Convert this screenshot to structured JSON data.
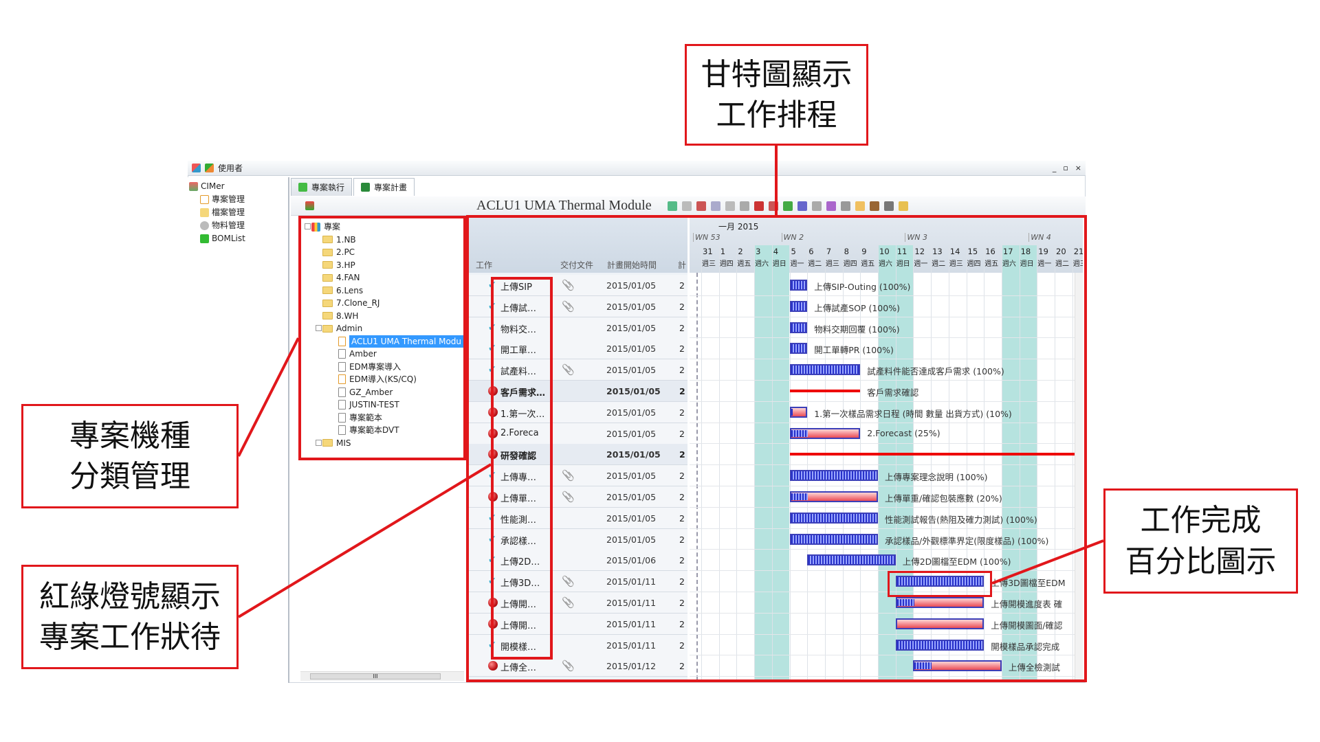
{
  "window": {
    "title": "使用者",
    "controls": [
      "_",
      "▫",
      "×"
    ]
  },
  "nav": {
    "root": "CIMer",
    "items": [
      {
        "label": "專案管理",
        "icon": "document-icon"
      },
      {
        "label": "檔案管理",
        "icon": "folder-icon"
      },
      {
        "label": "物料管理",
        "icon": "gear-icon"
      },
      {
        "label": "BOMList",
        "icon": "puzzle-icon"
      }
    ]
  },
  "tabs": [
    {
      "label": "專案執行"
    },
    {
      "label": "專案計畫",
      "active": true
    }
  ],
  "toolbar": {
    "project_title": "ACLU1 UMA Thermal Module"
  },
  "tree": {
    "root": "專案",
    "folders": [
      "1.NB",
      "2.PC",
      "3.HP",
      "4.FAN",
      "6.Lens",
      "7.Clone_RJ",
      "8.WH"
    ],
    "admin": {
      "label": "Admin",
      "children": [
        {
          "label": "ACLU1 UMA Thermal Modu",
          "selected": true,
          "orange": true
        },
        {
          "label": "Amber"
        },
        {
          "label": "EDM專案導入"
        },
        {
          "label": "EDM導入(KS/CQ)",
          "orange": true
        },
        {
          "label": "GZ_Amber"
        },
        {
          "label": "JUSTIN-TEST"
        },
        {
          "label": "專案範本"
        },
        {
          "label": "專案範本DVT"
        }
      ]
    },
    "collapsed": "MIS",
    "scroll_marker": "III"
  },
  "grid": {
    "columns": [
      "工作",
      "交付文件",
      "計畫開始時間",
      "計"
    ],
    "rows": [
      {
        "name": "上傳SIP",
        "status": "done",
        "attach": true,
        "start": "2015/01/05",
        "dur": "2",
        "gantt_label": "上傳SIP-Outing (100%)",
        "days": 1,
        "percent": 100
      },
      {
        "name": "上傳試…",
        "status": "done",
        "attach": true,
        "start": "2015/01/05",
        "dur": "2",
        "gantt_label": "上傳試產SOP (100%)",
        "days": 1,
        "percent": 100
      },
      {
        "name": "物料交…",
        "status": "done",
        "attach": false,
        "start": "2015/01/05",
        "dur": "2",
        "gantt_label": "物料交期回覆 (100%)",
        "days": 1,
        "percent": 100
      },
      {
        "name": "開工單…",
        "status": "done",
        "attach": false,
        "start": "2015/01/05",
        "dur": "2",
        "gantt_label": "開工單轉PR (100%)",
        "days": 1,
        "percent": 100
      },
      {
        "name": "試產料…",
        "status": "done",
        "attach": true,
        "start": "2015/01/05",
        "dur": "2",
        "gantt_label": "試產料件能否達成客戶需求 (100%)",
        "days": 4,
        "percent": 100
      },
      {
        "name": "客戶需求…",
        "status": "red",
        "summary": true,
        "attach": false,
        "start": "2015/01/05",
        "dur": "2",
        "gantt_label": "客戶需求確認",
        "days": 4
      },
      {
        "name": "1.第一次…",
        "status": "red",
        "attach": false,
        "start": "2015/01/05",
        "dur": "2",
        "gantt_label": "1.第一次樣品需求日程 (時間 數量 出貨方式) (10%)",
        "days": 1,
        "percent": 10
      },
      {
        "name": "2.Foreca",
        "status": "red",
        "attach": false,
        "start": "2015/01/05",
        "dur": "2",
        "gantt_label": "2.Forecast (25%)",
        "days": 4,
        "percent": 25
      },
      {
        "name": "研發確認",
        "status": "red",
        "summary": true,
        "attach": false,
        "start": "2015/01/05",
        "dur": "2",
        "gantt_label": "",
        "days": 17
      },
      {
        "name": "上傳專…",
        "status": "done",
        "attach": true,
        "start": "2015/01/05",
        "dur": "2",
        "gantt_label": "上傳專案理念說明 (100%)",
        "days": 5,
        "percent": 100
      },
      {
        "name": "上傳單…",
        "status": "red",
        "attach": true,
        "start": "2015/01/05",
        "dur": "2",
        "gantt_label": "上傳單重/確認包裝應數 (20%)",
        "days": 5,
        "percent": 20
      },
      {
        "name": "性能測…",
        "status": "done",
        "attach": false,
        "start": "2015/01/05",
        "dur": "2",
        "gantt_label": "性能測試報告(熱阻及確力測試) (100%)",
        "days": 5,
        "percent": 100
      },
      {
        "name": "承認樣…",
        "status": "done",
        "attach": false,
        "start": "2015/01/05",
        "dur": "2",
        "gantt_label": "承認樣品/外觀標準界定(限度樣品) (100%)",
        "days": 5,
        "percent": 100
      },
      {
        "name": "上傳2D…",
        "status": "done",
        "attach": false,
        "start": "2015/01/06",
        "dur": "2",
        "gantt_label": "上傳2D圖檔至EDM (100%)",
        "days": 5,
        "percent": 100
      },
      {
        "name": "上傳3D…",
        "status": "done",
        "attach": true,
        "start": "2015/01/11",
        "dur": "2",
        "gantt_label": "上傳3D圖檔至EDM",
        "days": 5,
        "percent": 100
      },
      {
        "name": "上傳開…",
        "status": "red",
        "attach": true,
        "start": "2015/01/11",
        "dur": "2",
        "gantt_label": "上傳開模進度表 確",
        "days": 5,
        "percent": 20
      },
      {
        "name": "上傳開…",
        "status": "red",
        "attach": false,
        "start": "2015/01/11",
        "dur": "2",
        "gantt_label": "上傳開模圖面/確認",
        "days": 5,
        "percent": 0
      },
      {
        "name": "開模樣…",
        "status": "done",
        "attach": false,
        "start": "2015/01/11",
        "dur": "2",
        "gantt_label": "開模樣品承認完成",
        "days": 5,
        "percent": 100
      },
      {
        "name": "上傳全…",
        "status": "red",
        "attach": true,
        "start": "2015/01/12",
        "dur": "2",
        "gantt_label": "上傳全檢測試",
        "days": 5,
        "percent": 20
      }
    ]
  },
  "gantt": {
    "month": "一月 2015",
    "weeks": [
      "WN 53",
      "WN 2",
      "WN 3",
      "WN 4"
    ],
    "days": [
      "31",
      "1",
      "2",
      "3",
      "4",
      "5",
      "6",
      "7",
      "8",
      "9",
      "10",
      "11",
      "12",
      "13",
      "14",
      "15",
      "16",
      "17",
      "18",
      "19",
      "20",
      "21"
    ],
    "weekdays": [
      "週三",
      "週四",
      "週五",
      "週六",
      "週日",
      "週一",
      "週二",
      "週三",
      "週四",
      "週五",
      "週六",
      "週日",
      "週一",
      "週二",
      "週三",
      "週四",
      "週五",
      "週六",
      "週日",
      "週一",
      "週二",
      "週三"
    ],
    "weekend_color": "#b6e3df",
    "done_color": "#2630c9",
    "todo_color": "#e94b55"
  },
  "callouts": {
    "gantt": [
      "甘特圖顯示",
      "工作排程"
    ],
    "tree": [
      "專案機種",
      "分類管理"
    ],
    "status": [
      "紅綠燈號顯示",
      "專案工作狀待"
    ],
    "percent": [
      "工作完成",
      "百分比圖示"
    ]
  },
  "highlight_color": "#e1171b"
}
